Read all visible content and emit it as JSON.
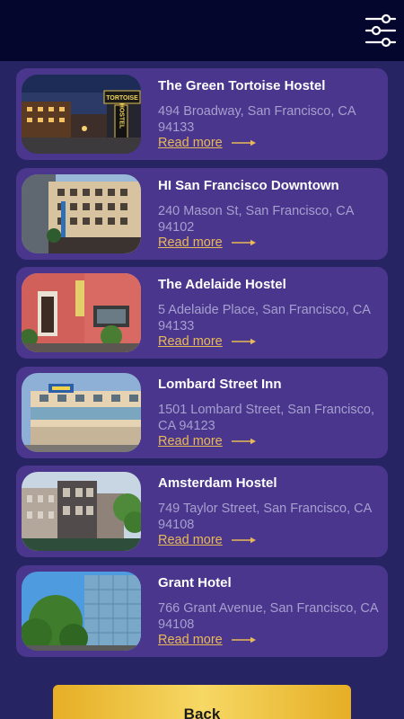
{
  "header": {
    "filter_icon": "sliders-filter-icon"
  },
  "hostels": [
    {
      "name": "The Green Tortoise Hostel",
      "address": "494 Broadway, San Francisco, CA 94133",
      "link_label": "Read more",
      "sign_text_1": "TORTOISE",
      "sign_text_2": "HOSTEL"
    },
    {
      "name": "HI San Francisco Downtown",
      "address": "240 Mason St, San Francisco, CA 94102",
      "link_label": "Read more"
    },
    {
      "name": "The Adelaide Hostel",
      "address": "5 Adelaide Place, San Francisco, CA 94133",
      "link_label": "Read more"
    },
    {
      "name": "Lombard Street Inn",
      "address": "1501 Lombard Street, San Francisco, CA 94123",
      "link_label": "Read more"
    },
    {
      "name": "Amsterdam Hostel",
      "address": "749 Taylor Street, San Francisco, CA 94108",
      "link_label": "Read more"
    },
    {
      "name": "Grant Hotel",
      "address": "766 Grant Avenue, San Francisco, CA 94108",
      "link_label": "Read more"
    }
  ],
  "footer": {
    "back_label": "Back"
  },
  "colors": {
    "background": "#262463",
    "topbar": "#05062e",
    "card": "#4a368d",
    "link": "#e8b956",
    "button": "#f0c440"
  }
}
